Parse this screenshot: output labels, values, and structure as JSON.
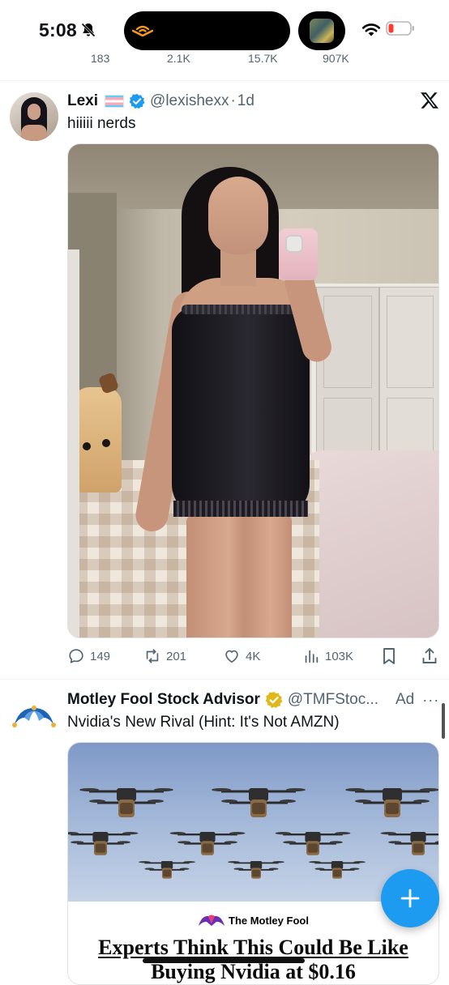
{
  "status_bar": {
    "time": "5:08",
    "icons": [
      "bell-slash-icon",
      "audible-icon",
      "app-thumbnail-icon",
      "wifi-icon",
      "battery-low-icon"
    ],
    "battery_color": "#ff3b30"
  },
  "previous_tweet": {
    "actions": [
      "183",
      "2.1K",
      "15.7K",
      "907K"
    ]
  },
  "tweet": {
    "name": "Lexi",
    "handle": "@lexishexx",
    "separator": "·",
    "time": "1d",
    "text": "hiiiii nerds",
    "icons": [
      "trans-flag-icon",
      "verified-badge-icon",
      "x-logo-icon"
    ],
    "actions": {
      "replies": "149",
      "reposts": "201",
      "likes": "4K",
      "views": "103K"
    }
  },
  "ad": {
    "name": "Motley Fool Stock Advisor",
    "handle": "@TMFStoc...",
    "badge": "Ad",
    "more": "···",
    "text": "Nvidia's New Rival (Hint: It's Not AMZN)",
    "card_brand": "The Motley Fool",
    "card_headline_line1": "Experts Think This Could Be Like",
    "card_headline_line2": "Buying Nvidia at $0.16"
  },
  "colors": {
    "accent": "#1d9bf0",
    "secondary_text": "#536471",
    "verified_blue": "#1d9bf0",
    "verified_gold": "#e2b719"
  }
}
